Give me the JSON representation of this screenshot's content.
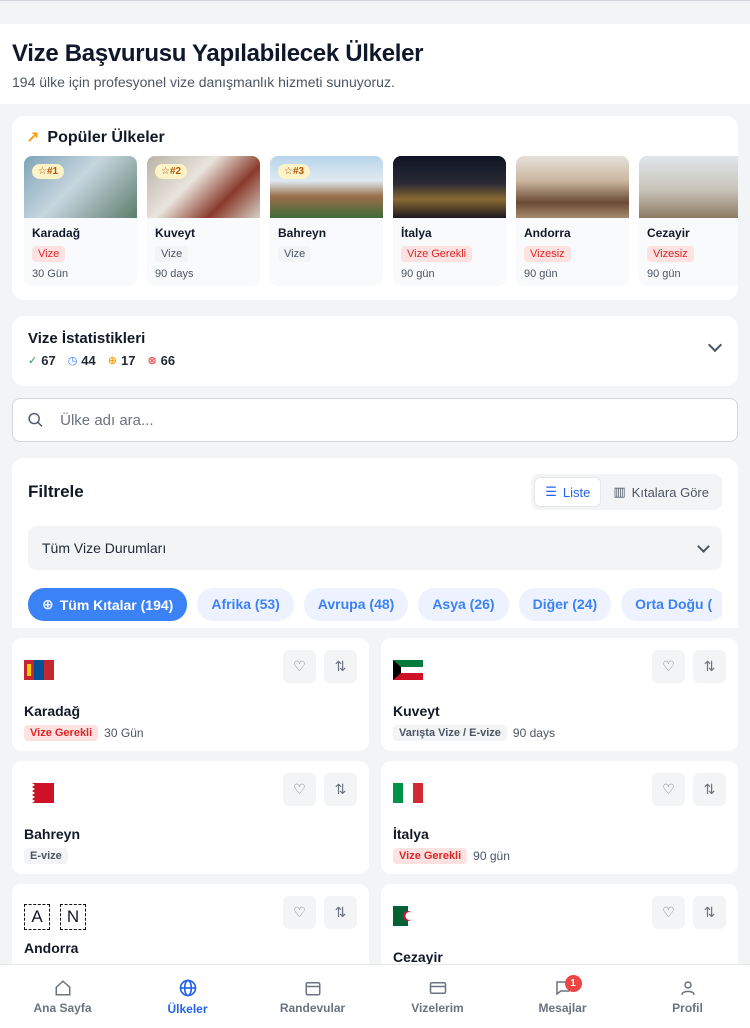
{
  "header": {
    "title": "Vize Başvurusu Yapılabilecek Ülkeler",
    "subtitle": "194 ülke için profesyonel vize danışmanlık hizmeti sunuyoruz."
  },
  "popular": {
    "title": "Popüler Ülkeler",
    "items": [
      {
        "rank": "☆#1",
        "name": "Karadağ",
        "badge": "Vize",
        "duration": "30 Gün"
      },
      {
        "rank": "☆#2",
        "name": "Kuveyt",
        "badge": "Vize",
        "duration": "90 days"
      },
      {
        "rank": "☆#3",
        "name": "Bahreyn",
        "badge": "Vize",
        "duration": ""
      },
      {
        "rank": "",
        "name": "İtalya",
        "badge": "Vize Gerekli",
        "duration": "90 gün"
      },
      {
        "rank": "",
        "name": "Andorra",
        "badge": "Vizesiz",
        "duration": "90 gün"
      },
      {
        "rank": "",
        "name": "Cezayir",
        "badge": "Vizesiz",
        "duration": "90 gün"
      }
    ]
  },
  "stats": {
    "title": "Vize İstatistikleri",
    "values": [
      "67",
      "44",
      "17",
      "66"
    ]
  },
  "search": {
    "placeholder": "Ülke adı ara..."
  },
  "filter": {
    "title": "Filtrele",
    "view_list": "Liste",
    "view_continent": "Kıtalara Göre",
    "status_select": "Tüm Vize Durumları",
    "chips": [
      "Tüm Kıtalar (194)",
      "Afrika (53)",
      "Avrupa (48)",
      "Asya (26)",
      "Diğer (24)",
      "Orta Doğu ("
    ]
  },
  "countries": [
    {
      "name": "Karadağ",
      "badge": "Vize Gerekli",
      "duration": "30 Gün"
    },
    {
      "name": "Kuveyt",
      "badge": "Varışta Vize / E-vize",
      "duration": "90 days"
    },
    {
      "name": "Bahreyn",
      "badge": "E-vize",
      "duration": ""
    },
    {
      "name": "İtalya",
      "badge": "Vize Gerekli",
      "duration": "90 gün"
    },
    {
      "name": "Andorra",
      "badge": "",
      "duration": "",
      "flag_letters": [
        "A",
        "N"
      ]
    },
    {
      "name": "Cezayir",
      "badge": "",
      "duration": ""
    }
  ],
  "nav": {
    "items": [
      "Ana Sayfa",
      "Ülkeler",
      "Randevular",
      "Vizelerim",
      "Mesajlar",
      "Profil"
    ],
    "messages_badge": "1"
  }
}
